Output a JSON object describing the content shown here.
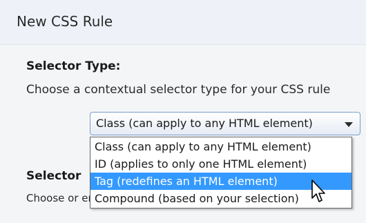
{
  "dialog": {
    "title": "New CSS Rule"
  },
  "selector_type": {
    "heading": "Selector Type:",
    "description": "Choose a contextual selector type for your CSS rule",
    "selected_value": "Class (can apply to any HTML element)",
    "options": [
      "Class (can apply to any HTML element)",
      "ID (applies to only one HTML element)",
      "Tag (redefines an HTML element)",
      "Compound (based on your selection)"
    ],
    "highlighted_index": 2
  },
  "selector_name": {
    "heading": "Selector",
    "description": "Choose or enter a name for your selector."
  },
  "icons": {
    "dropdown": "chevron-down-icon",
    "cursor": "mouse-pointer-icon"
  },
  "colors": {
    "highlight": "#3399ff",
    "titlebar": "#eef2f8",
    "background": "#f4f5f7"
  }
}
